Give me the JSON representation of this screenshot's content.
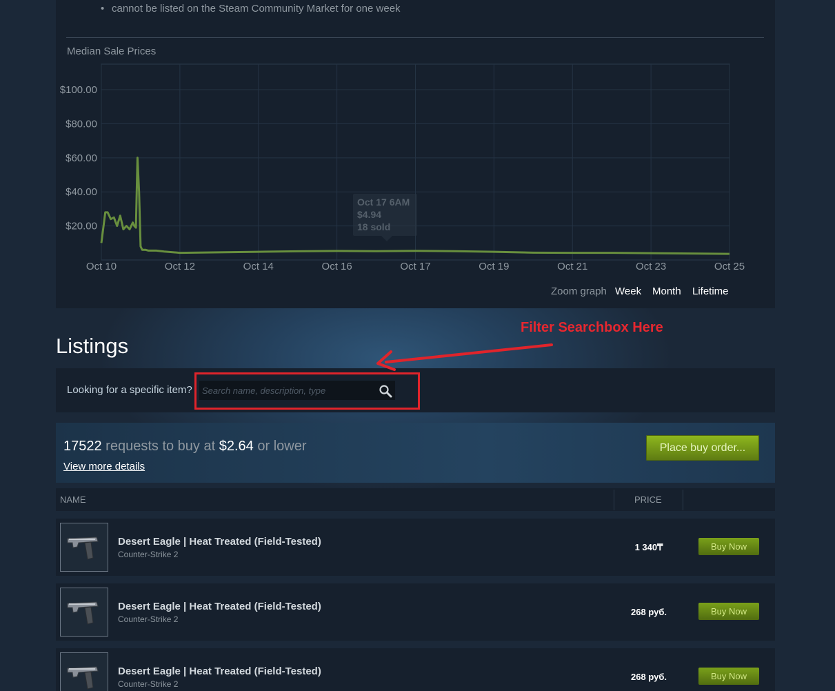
{
  "description": {
    "bullet": "•",
    "notice": "cannot be listed on the Steam Community Market for one week"
  },
  "chart_data": {
    "type": "line",
    "title": "Median Sale Prices",
    "x_tick_labels": [
      "Oct 10",
      "Oct 12",
      "Oct 14",
      "Oct 16",
      "Oct 17",
      "Oct 19",
      "Oct 21",
      "Oct 23",
      "Oct 25"
    ],
    "y_tick_labels": [
      "$20.00",
      "$40.00",
      "$60.00",
      "$80.00",
      "$100.00"
    ],
    "ylim": [
      0,
      115
    ],
    "grid": true,
    "series": [
      {
        "color": "#688f3e",
        "x": [
          0,
          0.05,
          0.08,
          0.12,
          0.16,
          0.2,
          0.24,
          0.28,
          0.32,
          0.36,
          0.38,
          0.4,
          0.42,
          0.44,
          0.46,
          0.48,
          0.5,
          0.52,
          0.56,
          0.6,
          0.7,
          0.8,
          1.0,
          1.5,
          2.0,
          2.5,
          3.0,
          3.5,
          4.0,
          4.5,
          5.0,
          5.5,
          6.0,
          6.5,
          7.0,
          7.5,
          8.0
        ],
        "y": [
          10,
          28,
          28,
          24,
          25,
          20,
          26,
          18,
          20,
          18,
          20,
          22,
          20,
          19,
          60,
          40,
          8,
          6,
          6,
          5.5,
          5.5,
          5,
          4.2,
          4.5,
          4.8,
          5.1,
          5.3,
          5.2,
          5.4,
          5.2,
          4.8,
          4.3,
          4.2,
          4.2,
          4.0,
          3.8,
          3.6
        ]
      }
    ],
    "tooltip": {
      "date": "Oct 17 6AM",
      "price": "$4.94",
      "sold": "18 sold"
    }
  },
  "zoom": {
    "label": "Zoom graph",
    "options": [
      "Week",
      "Month",
      "Lifetime"
    ]
  },
  "listings": {
    "title": "Listings",
    "annotation": "Filter Searchbox Here",
    "filter_label": "Looking for a specific item?",
    "filter_placeholder": "Search name, description, type"
  },
  "buy_order": {
    "count": "17522",
    "text_mid": " requests to buy at ",
    "price": "$2.64",
    "text_end": " or lower",
    "details_link": "View more details",
    "button": "Place buy order..."
  },
  "table": {
    "col_name": "NAME",
    "col_price": "PRICE",
    "rows": [
      {
        "name": "Desert Eagle | Heat Treated (Field-Tested)",
        "game": "Counter-Strike 2",
        "price": "1 340₸",
        "button": "Buy Now"
      },
      {
        "name": "Desert Eagle | Heat Treated (Field-Tested)",
        "game": "Counter-Strike 2",
        "price": "268 руб.",
        "button": "Buy Now"
      },
      {
        "name": "Desert Eagle | Heat Treated (Field-Tested)",
        "game": "Counter-Strike 2",
        "price": "268 руб.",
        "button": "Buy Now"
      }
    ]
  }
}
